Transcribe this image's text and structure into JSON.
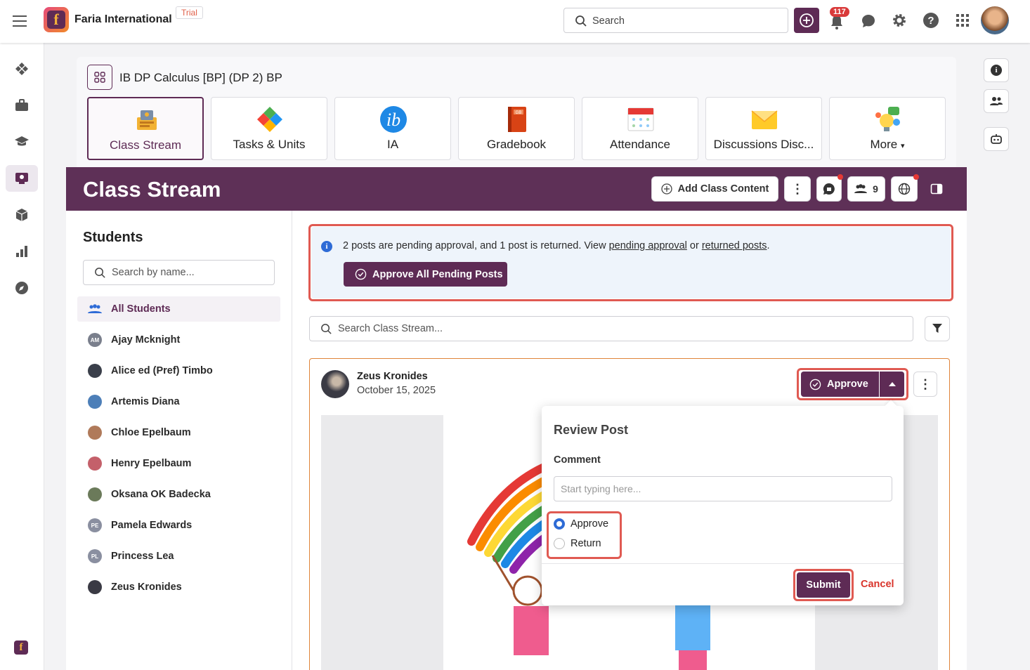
{
  "topbar": {
    "menu_icon": "hamburger-icon",
    "org_name": "Faria International",
    "trial_badge": "Trial",
    "search_placeholder": "Search",
    "notification_count": "117"
  },
  "course": {
    "title": "IB DP Calculus [BP] (DP 2) BP",
    "tiles": [
      {
        "label": "Class Stream",
        "icon": "class-stream-icon"
      },
      {
        "label": "Tasks & Units",
        "icon": "puzzle-icon"
      },
      {
        "label": "IA",
        "icon": "ib-icon"
      },
      {
        "label": "Gradebook",
        "icon": "gradebook-icon"
      },
      {
        "label": "Attendance",
        "icon": "attendance-icon"
      },
      {
        "label": "Discussions Disc...",
        "icon": "envelope-icon"
      },
      {
        "label": "More",
        "icon": "lightbulb-icon"
      }
    ]
  },
  "stream_header": {
    "title": "Class Stream",
    "add_content_label": "Add Class Content",
    "members_count": "9"
  },
  "students": {
    "heading": "Students",
    "search_placeholder": "Search by name...",
    "all_label": "All Students",
    "list": [
      {
        "name": "Ajay Mcknight",
        "initials": "AM",
        "color": "#7a7f8c"
      },
      {
        "name": "Alice ed (Pref) Timbo",
        "initials": "",
        "color": "#3a3f4a"
      },
      {
        "name": "Artemis Diana",
        "initials": "",
        "color": "#4d7fb8"
      },
      {
        "name": "Chloe Epelbaum",
        "initials": "",
        "color": "#b07a5a"
      },
      {
        "name": "Henry Epelbaum",
        "initials": "",
        "color": "#c4606a"
      },
      {
        "name": "Oksana OK Badecka",
        "initials": "",
        "color": "#6b7a5a"
      },
      {
        "name": "Pamela Edwards",
        "initials": "PE",
        "color": "#8a8fa0"
      },
      {
        "name": "Princess Lea",
        "initials": "PL",
        "color": "#8a8fa0"
      },
      {
        "name": "Zeus Kronides",
        "initials": "",
        "color": "#3a3a44"
      }
    ]
  },
  "notice": {
    "text_before": "2 posts are pending approval, and 1 post is returned. View ",
    "link1": "pending approval",
    "text_mid": " or ",
    "link2": "returned posts",
    "text_after": ".",
    "approve_all_label": "Approve All Pending Posts"
  },
  "stream_search": {
    "placeholder": "Search Class Stream..."
  },
  "post": {
    "author": "Zeus Kronides",
    "date": "October 15, 2025",
    "approve_label": "Approve"
  },
  "review_popup": {
    "title": "Review Post",
    "comment_label": "Comment",
    "comment_placeholder": "Start typing here...",
    "options": [
      "Approve",
      "Return"
    ],
    "selected": "Approve",
    "submit_label": "Submit",
    "cancel_label": "Cancel"
  }
}
